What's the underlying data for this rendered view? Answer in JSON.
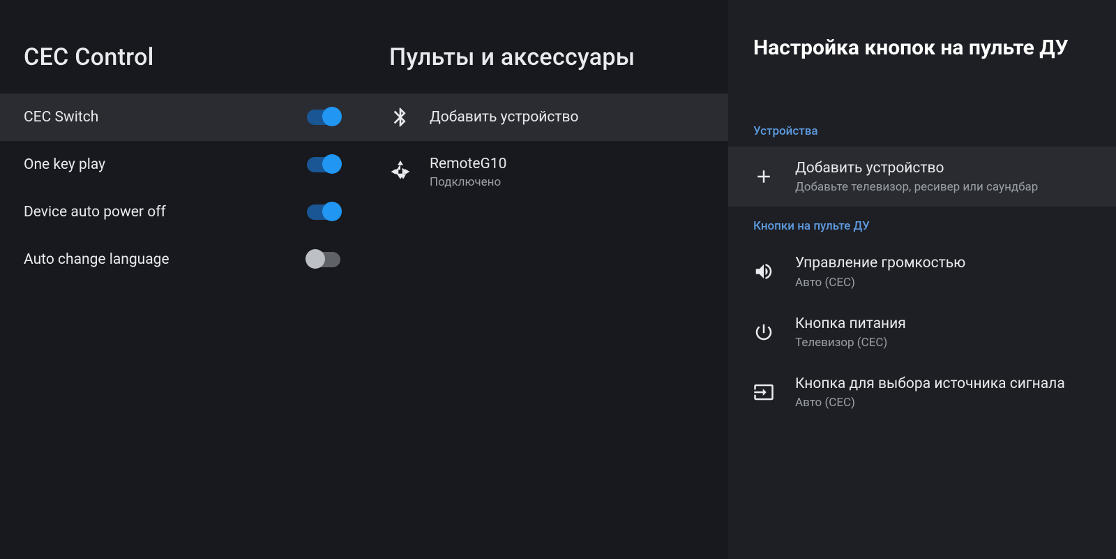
{
  "col1": {
    "title": "CEC Control",
    "items": [
      {
        "label": "CEC Switch",
        "on": true
      },
      {
        "label": "One key play",
        "on": true
      },
      {
        "label": "Device auto power off",
        "on": true
      },
      {
        "label": "Auto change language",
        "on": false
      }
    ]
  },
  "col2": {
    "title": "Пульты и аксессуары",
    "add_device": "Добавить устройство",
    "device": {
      "name": "RemoteG10",
      "status": "Подключено"
    }
  },
  "col3": {
    "title": "Настройка кнопок на пульте ДУ",
    "section_devices": "Устройства",
    "add": {
      "label": "Добавить устройство",
      "sub": "Добавьте телевизор, ресивер или саундбар"
    },
    "section_buttons": "Кнопки на пульте ДУ",
    "volume": {
      "label": "Управление громкостью",
      "sub": "Авто (CEC)"
    },
    "power": {
      "label": "Кнопка питания",
      "sub": "Телевизор (CEC)"
    },
    "input": {
      "label": "Кнопка для выбора источника сигнала",
      "sub": "Авто (CEC)"
    }
  }
}
